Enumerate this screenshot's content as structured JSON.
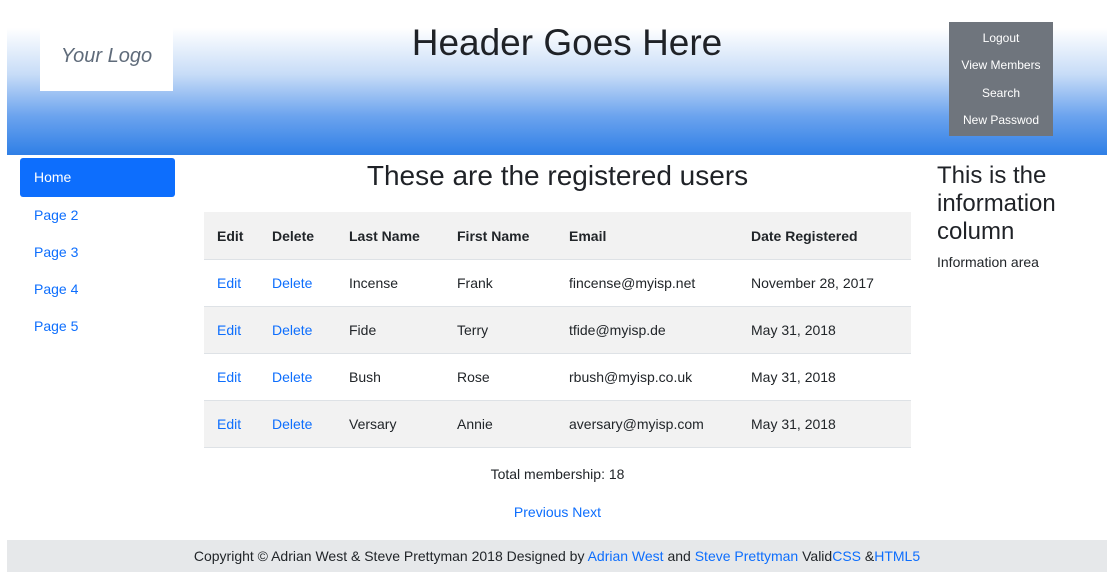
{
  "header": {
    "logo_text": "Your Logo",
    "title": "Header Goes Here",
    "menu": [
      "Logout",
      "View Members",
      "Search",
      "New Passwod"
    ]
  },
  "nav": {
    "items": [
      "Home",
      "Page 2",
      "Page 3",
      "Page 4",
      "Page 5"
    ],
    "active": "Home"
  },
  "main": {
    "title": "These are the registered users",
    "columns": [
      "Edit",
      "Delete",
      "Last Name",
      "First Name",
      "Email",
      "Date Registered"
    ],
    "rows": [
      {
        "edit": "Edit",
        "delete": "Delete",
        "last": "Incense",
        "first": "Frank",
        "email": "fincense@myisp.net",
        "date": "November 28, 2017"
      },
      {
        "edit": "Edit",
        "delete": "Delete",
        "last": "Fide",
        "first": "Terry",
        "email": "tfide@myisp.de",
        "date": "May 31, 2018"
      },
      {
        "edit": "Edit",
        "delete": "Delete",
        "last": "Bush",
        "first": "Rose",
        "email": "rbush@myisp.co.uk",
        "date": "May 31, 2018"
      },
      {
        "edit": "Edit",
        "delete": "Delete",
        "last": "Versary",
        "first": "Annie",
        "email": "aversary@myisp.com",
        "date": "May 31, 2018"
      }
    ],
    "total_text": "Total membership: 18",
    "pager": {
      "previous": "Previous",
      "next": "Next"
    }
  },
  "aside": {
    "title": "This is the information column",
    "text": "Information area"
  },
  "footer": {
    "copyright": "Copyright © Adrian West & Steve Prettyman 2018 Designed by",
    "author1": "Adrian West",
    "and": "and",
    "author2": "Steve Prettyman",
    "valid": "Valid",
    "css": "CSS",
    "amp": "&",
    "html5": "HTML5"
  },
  "colors": {
    "accent": "#0d6efd",
    "header_gradient_end": "#2f7fe6",
    "menu_bg": "#6f757d"
  }
}
